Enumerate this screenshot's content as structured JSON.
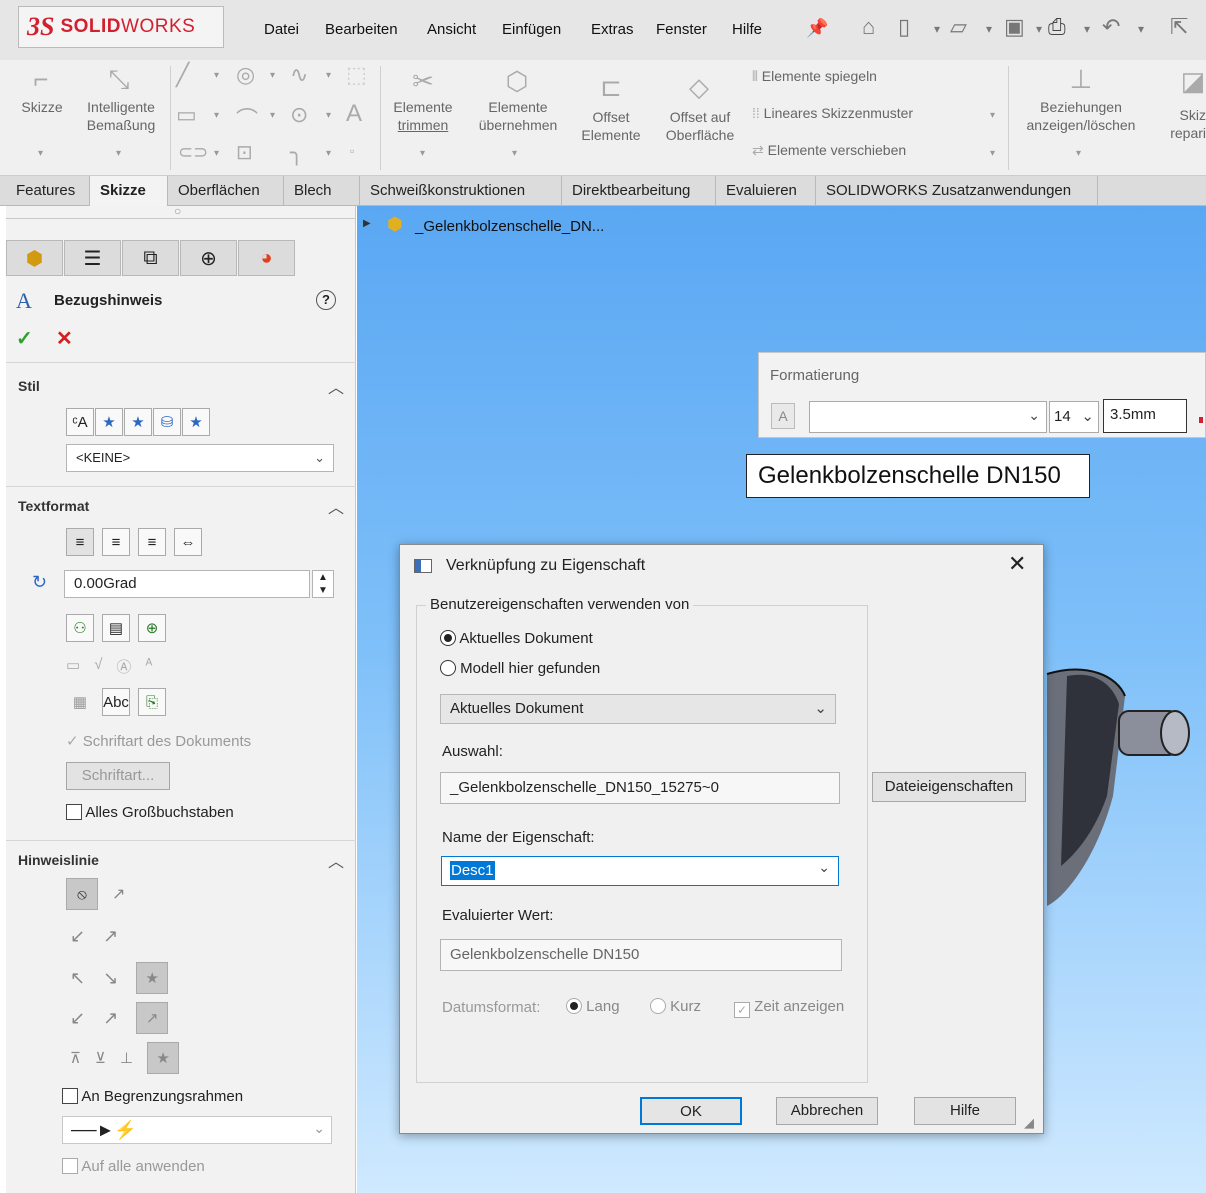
{
  "app": {
    "brand_ds": "3S",
    "brand_name_bold": "SOLID",
    "brand_name_rest": "WORKS"
  },
  "menu": [
    "Datei",
    "Bearbeiten",
    "Ansicht",
    "Einfügen",
    "Extras",
    "Fenster",
    "Hilfe"
  ],
  "ribbon": {
    "skizze": "Skizze",
    "intelligente_1": "Intelligente",
    "intelligente_2": "Bemaßung",
    "trimmen_1": "Elemente",
    "trimmen_2": "trimmen",
    "uebernehmen_1": "Elemente",
    "uebernehmen_2": "übernehmen",
    "offset_1": "Offset",
    "offset_2": "Elemente",
    "offset_flaeche_1": "Offset auf",
    "offset_flaeche_2": "Oberfläche",
    "spiegeln": "Elemente spiegeln",
    "muster": "Lineares Skizzenmuster",
    "verschieben": "Elemente verschieben",
    "beziehungen_1": "Beziehungen",
    "beziehungen_2": "anzeigen/löschen",
    "reparieren_1": "Skiz",
    "reparieren_2": "repari"
  },
  "tabs": [
    "Features",
    "Skizze",
    "Oberflächen",
    "Blech",
    "Schweißkonstruktionen",
    "Direktbearbeitung",
    "Evaluieren",
    "SOLIDWORKS Zusatzanwendungen"
  ],
  "active_tab": "Skizze",
  "tree": {
    "root": "_Gelenkbolzenschelle_DN..."
  },
  "panel": {
    "title": "Bezugshinweis",
    "help": "?",
    "ok": "✓",
    "cancel": "✕",
    "stil_header": "Stil",
    "stil_value": "<KEINE>",
    "textformat_header": "Textformat",
    "angle_value": "0.00Grad",
    "schriftart_dokument": "Schriftart des Dokuments",
    "schriftart_button": "Schriftart...",
    "alles_gross": "Alles Großbuchstaben",
    "hinweislinie_header": "Hinweislinie",
    "begrenzungsrahmen": "An Begrenzungsrahmen",
    "alle_anwenden": "Auf alle anwenden"
  },
  "formatting": {
    "title": "Formatierung",
    "font_size": "14",
    "height": "3.5mm"
  },
  "annotation_text": "Gelenkbolzenschelle DN150",
  "dialog": {
    "title": "Verknüpfung zu Eigenschaft",
    "group_label": "Benutzereigenschaften verwenden von",
    "radio_current": "Aktuelles Dokument",
    "radio_model": "Modell hier gefunden",
    "source_select": "Aktuelles Dokument",
    "auswahl_label": "Auswahl:",
    "auswahl_value": "_Gelenkbolzenschelle_DN150_15275~0",
    "dateieigenschaften": "Dateieigenschaften",
    "name_label": "Name der Eigenschaft:",
    "name_value": "Desc1",
    "evaluated_label": "Evaluierter Wert:",
    "evaluated_value": "Gelenkbolzenschelle DN150",
    "datumsformat_label": "Datumsformat:",
    "lang": "Lang",
    "kurz": "Kurz",
    "zeit": "Zeit anzeigen",
    "ok": "OK",
    "abbrechen": "Abbrechen",
    "hilfe": "Hilfe"
  },
  "colors": {
    "accent_red": "#d2202f",
    "viewport_top": "#5aa7f3",
    "selection_blue": "#0078d7"
  }
}
